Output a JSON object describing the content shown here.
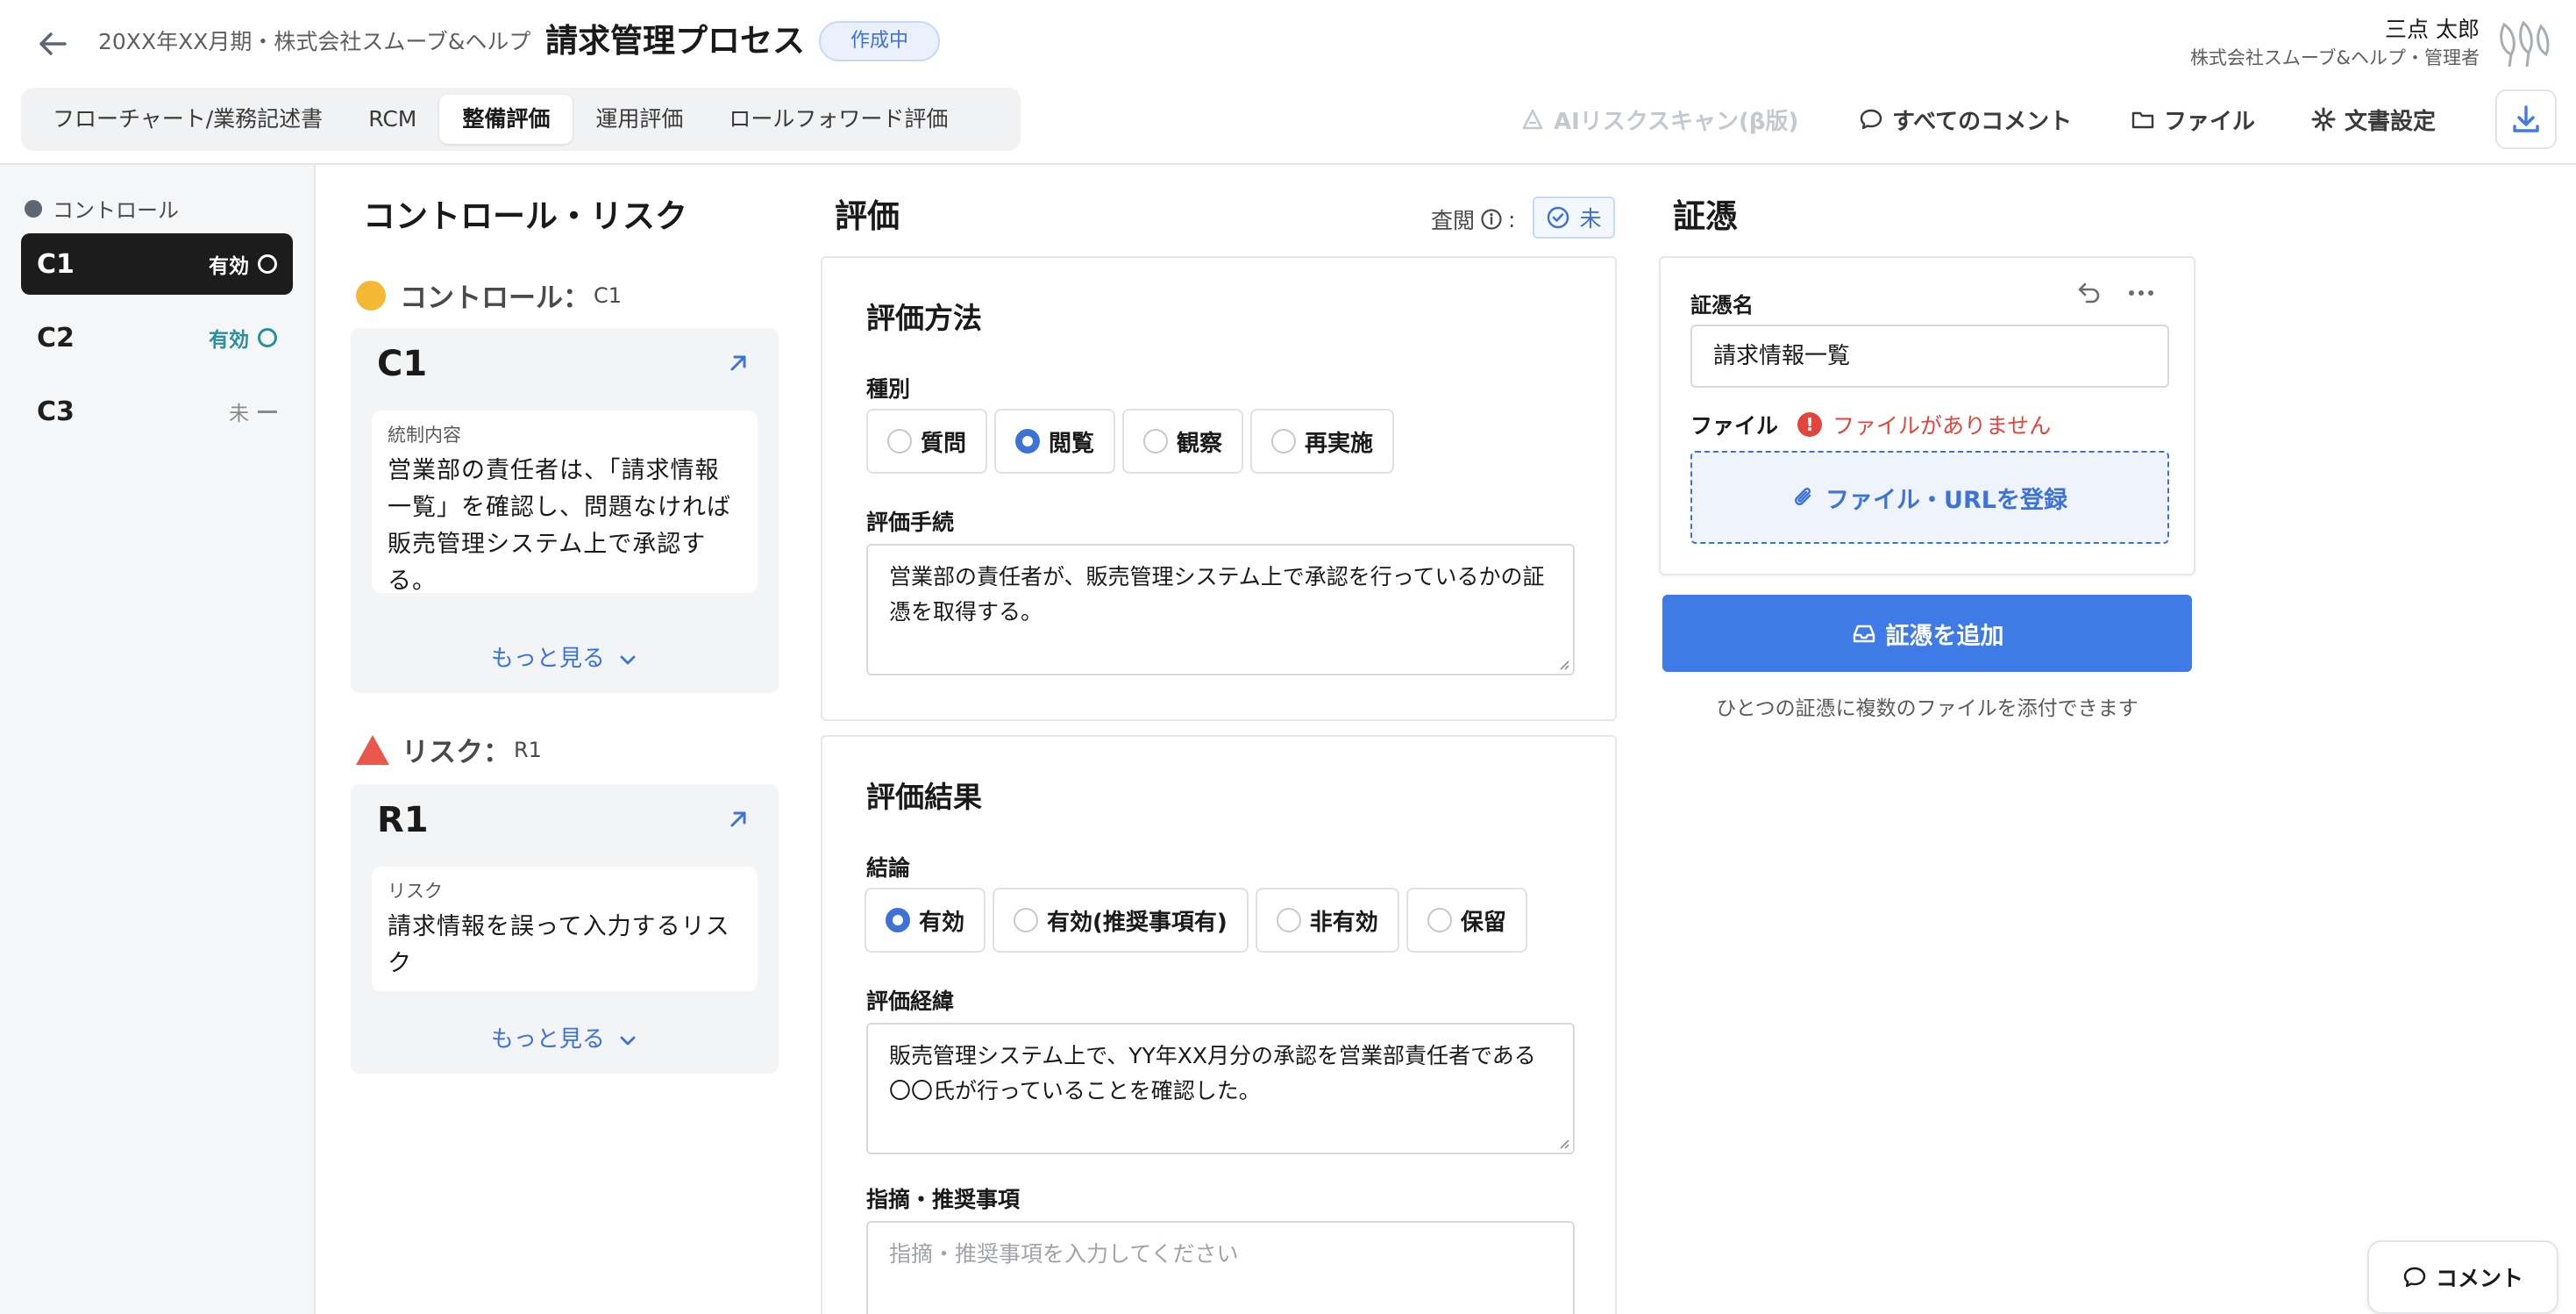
{
  "header": {
    "breadcrumb": "20XX年XX月期・株式会社スムーブ&ヘルプ",
    "title": "請求管理プロセス",
    "status": "作成中",
    "user_name": "三点 太郎",
    "user_org": "株式会社スムーブ&ヘルプ・管理者"
  },
  "tabs": [
    {
      "label": "フローチャート/業務記述書"
    },
    {
      "label": "RCM"
    },
    {
      "label": "整備評価",
      "active": true
    },
    {
      "label": "運用評価"
    },
    {
      "label": "ロールフォワード評価"
    }
  ],
  "toolbar": {
    "ai_scan": "AIリスクスキャン(β版)",
    "all_comments": "すべてのコメント",
    "files": "ファイル",
    "doc_settings": "文書設定"
  },
  "sidebar": {
    "title": "コントロール",
    "items": [
      {
        "name": "C1",
        "status": "有効"
      },
      {
        "name": "C2",
        "status": "有効"
      },
      {
        "name": "C3",
        "status": "未"
      }
    ]
  },
  "control_risk": {
    "title": "コントロール・リスク",
    "control_label": "コントロール：",
    "control_code_small": "C1",
    "control_code": "C1",
    "control_content_label": "統制内容",
    "control_content": "営業部の責任者は、「請求情報一覧」を確認し、問題なければ販売管理システム上で承認する。",
    "more": "もっと見る",
    "risk_label": "リスク：",
    "risk_code_small": "R1",
    "risk_code": "R1",
    "risk_content_label": "リスク",
    "risk_content": "請求情報を誤って入力するリスク"
  },
  "evaluation": {
    "title": "評価",
    "review_label": "査閲",
    "review_status": "未",
    "method": {
      "title": "評価方法",
      "type_label": "種別",
      "types": [
        "質問",
        "閲覧",
        "観察",
        "再実施"
      ],
      "selected_type": 1,
      "procedure_label": "評価手続",
      "procedure": "営業部の責任者が、販売管理システム上で承認を行っているかの証憑を取得する。"
    },
    "result": {
      "title": "評価結果",
      "conclusion_label": "結論",
      "conclusions": [
        "有効",
        "有効(推奨事項有)",
        "非有効",
        "保留"
      ],
      "selected_conclusion": 0,
      "history_label": "評価経緯",
      "history": "販売管理システム上で、YY年XX月分の承認を営業部責任者である〇〇氏が行っていることを確認した。",
      "findings_label": "指摘・推奨事項",
      "findings_placeholder": "指摘・推奨事項を入力してください"
    }
  },
  "evidence": {
    "title": "証憑",
    "name_label": "証憑名",
    "name_value": "請求情報一覧",
    "file_label": "ファイル",
    "no_file": "ファイルがありません",
    "upload": "ファイル・URLを登録",
    "add_button": "証憑を追加",
    "hint": "ひとつの証憑に複数のファイルを添付できます"
  },
  "comment_button": "コメント",
  "colors": {
    "accent": "#3f7be6",
    "effective_teal": "#2a8f9a",
    "error": "#e2453b",
    "control_marker": "#f4b834",
    "risk_marker": "#e8574a"
  }
}
